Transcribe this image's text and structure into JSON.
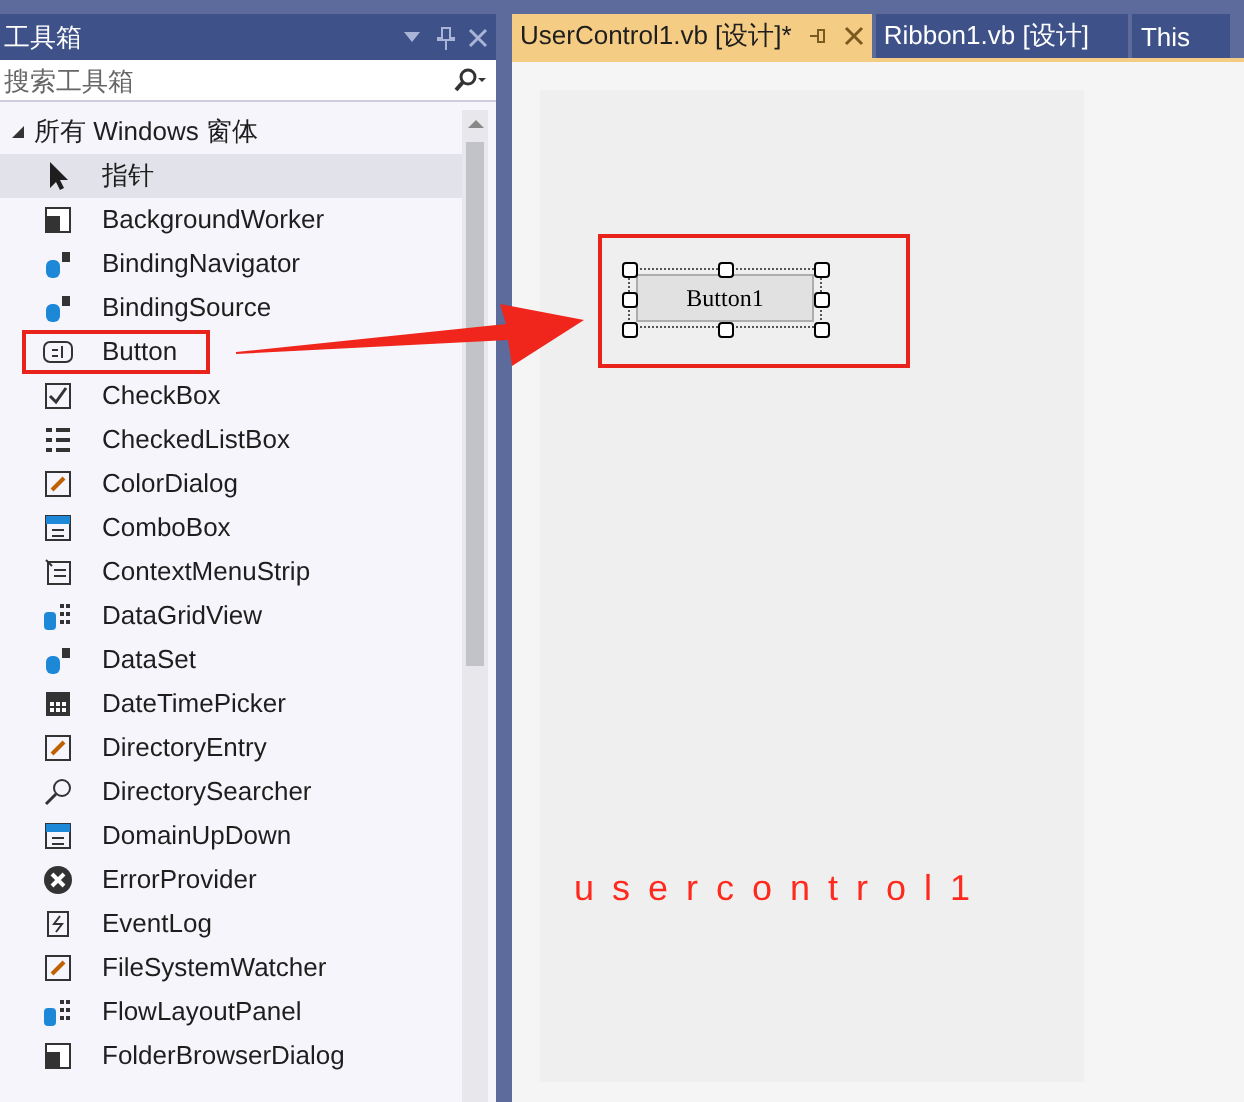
{
  "toolbox": {
    "title": "工具箱",
    "search": {
      "placeholder": "搜索工具箱"
    },
    "group": {
      "label": "所有 Windows 窗体",
      "expanded": true
    },
    "items": [
      {
        "label": "指针",
        "kind": "pointer",
        "selected": true,
        "marked": false
      },
      {
        "label": "BackgroundWorker",
        "kind": "component",
        "selected": false,
        "marked": false
      },
      {
        "label": "BindingNavigator",
        "kind": "data",
        "selected": false,
        "marked": false
      },
      {
        "label": "BindingSource",
        "kind": "data",
        "selected": false,
        "marked": false
      },
      {
        "label": "Button",
        "kind": "button",
        "selected": false,
        "marked": true
      },
      {
        "label": "CheckBox",
        "kind": "checkbox",
        "selected": false,
        "marked": false
      },
      {
        "label": "CheckedListBox",
        "kind": "list",
        "selected": false,
        "marked": false
      },
      {
        "label": "ColorDialog",
        "kind": "dialog",
        "selected": false,
        "marked": false
      },
      {
        "label": "ComboBox",
        "kind": "combo",
        "selected": false,
        "marked": false
      },
      {
        "label": "ContextMenuStrip",
        "kind": "menu",
        "selected": false,
        "marked": false
      },
      {
        "label": "DataGridView",
        "kind": "grid",
        "selected": false,
        "marked": false
      },
      {
        "label": "DataSet",
        "kind": "data",
        "selected": false,
        "marked": false
      },
      {
        "label": "DateTimePicker",
        "kind": "calendar",
        "selected": false,
        "marked": false
      },
      {
        "label": "DirectoryEntry",
        "kind": "dialog",
        "selected": false,
        "marked": false
      },
      {
        "label": "DirectorySearcher",
        "kind": "search",
        "selected": false,
        "marked": false
      },
      {
        "label": "DomainUpDown",
        "kind": "combo",
        "selected": false,
        "marked": false
      },
      {
        "label": "ErrorProvider",
        "kind": "error",
        "selected": false,
        "marked": false
      },
      {
        "label": "EventLog",
        "kind": "log",
        "selected": false,
        "marked": false
      },
      {
        "label": "FileSystemWatcher",
        "kind": "dialog",
        "selected": false,
        "marked": false
      },
      {
        "label": "FlowLayoutPanel",
        "kind": "grid",
        "selected": false,
        "marked": false
      },
      {
        "label": "FolderBrowserDialog",
        "kind": "component",
        "selected": false,
        "marked": false
      }
    ]
  },
  "tabs": [
    {
      "label": "UserControl1.vb [设计]*",
      "selected": true
    },
    {
      "label": "Ribbon1.vb [设计]",
      "selected": false
    },
    {
      "label": "This",
      "selected": false
    }
  ],
  "designer": {
    "button": {
      "label": "Button1",
      "marked": true
    },
    "caption": "usercontrol1"
  }
}
